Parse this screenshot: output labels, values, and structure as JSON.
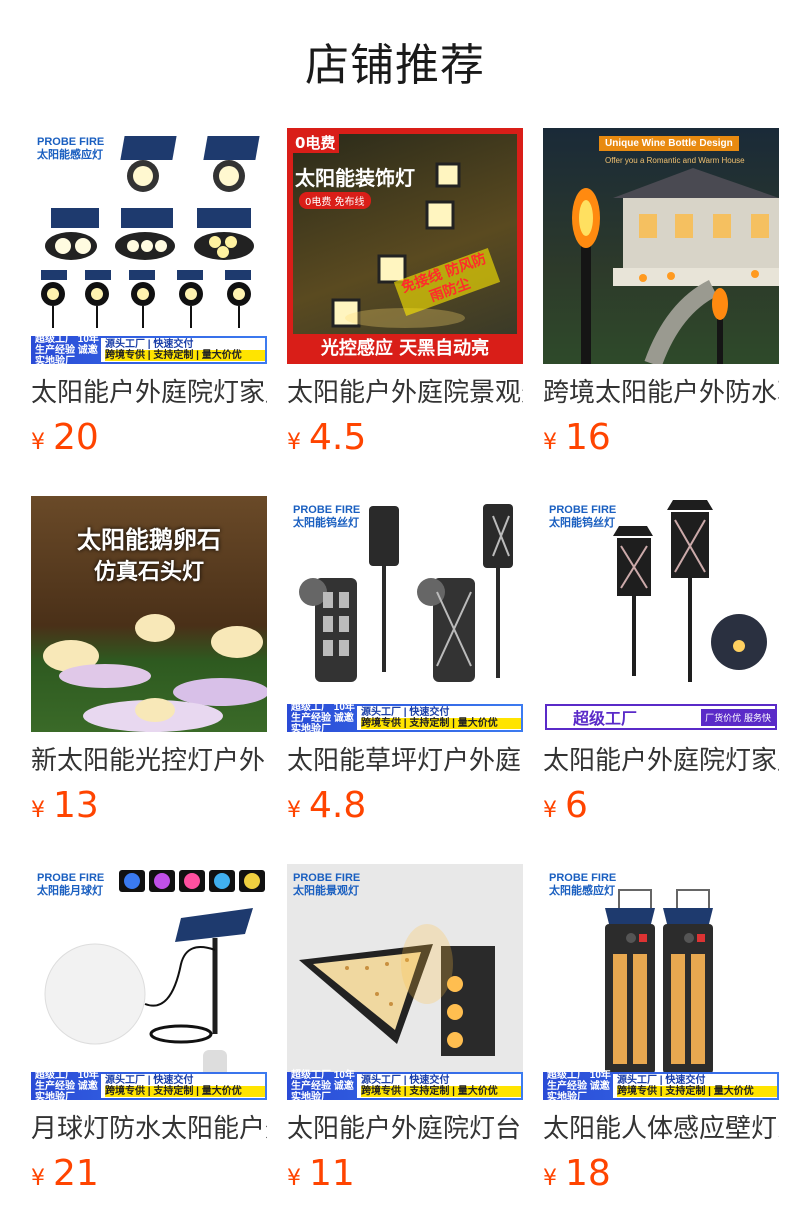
{
  "header": {
    "title": "店铺推荐"
  },
  "currency": "¥",
  "products": [
    {
      "name": "太阳能户外庭院灯家用",
      "price": "20",
      "image": {
        "brand": "PROBE FIRE",
        "sub": "太阳能感应灯",
        "badge_left": "超级工厂 10年生产经验 诚邀实地验厂",
        "badge_top": "源头工厂 | 快速交付",
        "badge_bottom": "跨境专供 | 支持定制 | 量大价优"
      }
    },
    {
      "name": "太阳能户外庭院景观灯",
      "price": "4.5",
      "image": {
        "corner": "0电费",
        "title": "太阳能装饰灯",
        "tags": "0电费  免布线",
        "stamp": "免接线 防风防雨防尘",
        "footer": "光控感应 天黑自动亮"
      }
    },
    {
      "name": "跨境太阳能户外防水草",
      "price": "16",
      "image": {
        "title": "Unique Wine Bottle Design",
        "sub": "Offer you a Romantic and Warm House"
      }
    },
    {
      "name": "新太阳能光控灯户外防",
      "price": "13",
      "image": {
        "title": "太阳能鹅卵石",
        "sub": "仿真石头灯"
      }
    },
    {
      "name": "太阳能草坪灯户外庭院",
      "price": "4.8",
      "image": {
        "brand": "PROBE FIRE",
        "sub": "太阳能钨丝灯",
        "badge_left": "超级工厂 10年生产经验 诚邀实地验厂",
        "badge_top": "源头工厂 | 快速交付",
        "badge_bottom": "跨境专供 | 支持定制 | 量大价优"
      }
    },
    {
      "name": "太阳能户外庭院灯家用",
      "price": "6",
      "image": {
        "brand": "PROBE FIRE",
        "sub": "太阳能钨丝灯",
        "banner": "超级工厂",
        "banner_right": "厂货价优 服务快"
      }
    },
    {
      "name": "月球灯防水太阳能户外",
      "price": "21",
      "image": {
        "brand": "PROBE FIRE",
        "sub": "太阳能月球灯",
        "badge_left": "超级工厂 10年生产经验 诚邀实地验厂",
        "badge_top": "源头工厂 | 快速交付",
        "badge_bottom": "跨境专供 | 支持定制 | 量大价优"
      }
    },
    {
      "name": "太阳能户外庭院灯台阶",
      "price": "11",
      "image": {
        "brand": "PROBE FIRE",
        "sub": "太阳能景观灯",
        "badge_left": "超级工厂 10年生产经验 诚邀实地验厂",
        "badge_top": "源头工厂 | 快速交付",
        "badge_bottom": "跨境专供 | 支持定制 | 量大价优"
      }
    },
    {
      "name": "太阳能人体感应壁灯家",
      "price": "18",
      "image": {
        "brand": "PROBE FIRE",
        "sub": "太阳能感应灯",
        "badge_left": "超级工厂 10年生产经验 诚邀实地验厂",
        "badge_top": "源头工厂 | 快速交付",
        "badge_bottom": "跨境专供 | 支持定制 | 量大价优"
      }
    }
  ]
}
